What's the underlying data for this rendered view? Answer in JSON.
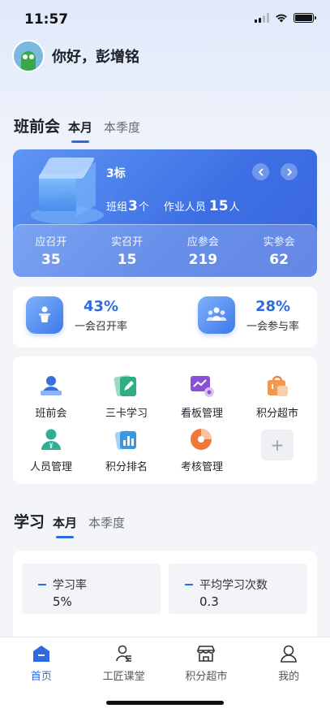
{
  "status": {
    "time": "11:57"
  },
  "greeting": "你好，彭增铭",
  "meeting": {
    "title": "班前会",
    "tabs": [
      "本月",
      "本季度"
    ],
    "banner": {
      "name": "3标",
      "group_label": "班组",
      "group_count": "3",
      "group_unit": "个",
      "workers_label": "作业人员",
      "workers_count": "15",
      "workers_unit": "人",
      "stats": [
        {
          "label": "应召开",
          "value": "35"
        },
        {
          "label": "实召开",
          "value": "15"
        },
        {
          "label": "应参会",
          "value": "219"
        },
        {
          "label": "实参会",
          "value": "62"
        }
      ]
    },
    "rates": [
      {
        "value": "43%",
        "label": "一会召开率",
        "icon": "podium-icon"
      },
      {
        "value": "28%",
        "label": "一会参与率",
        "icon": "team-icon"
      }
    ]
  },
  "grid": [
    {
      "label": "班前会",
      "icon": "meeting-person-icon"
    },
    {
      "label": "三卡学习",
      "icon": "edit-card-icon"
    },
    {
      "label": "看板管理",
      "icon": "dashboard-icon"
    },
    {
      "label": "积分超市",
      "icon": "shopping-bag-icon"
    },
    {
      "label": "人员管理",
      "icon": "person-icon"
    },
    {
      "label": "积分排名",
      "icon": "ranking-chart-icon"
    },
    {
      "label": "考核管理",
      "icon": "assessment-icon"
    }
  ],
  "add_label": "+",
  "study": {
    "title": "学习",
    "tabs": [
      "本月",
      "本季度"
    ],
    "items": [
      {
        "label": "学习率",
        "value": "5%"
      },
      {
        "label": "平均学习次数",
        "value": "0.3"
      }
    ]
  },
  "tabbar": [
    {
      "label": "首页",
      "icon": "home-icon",
      "active": true
    },
    {
      "label": "工匠课堂",
      "icon": "classroom-icon",
      "active": false
    },
    {
      "label": "积分超市",
      "icon": "store-icon",
      "active": false
    },
    {
      "label": "我的",
      "icon": "profile-icon",
      "active": false
    }
  ],
  "colors": {
    "accent": "#2f6ae0",
    "banner": "#3d6fe4"
  }
}
